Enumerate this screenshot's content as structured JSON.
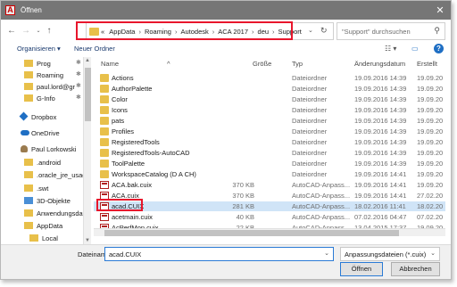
{
  "window": {
    "title": "Öffnen"
  },
  "address": {
    "prefix": "«",
    "crumbs": [
      "AppData",
      "Roaming",
      "Autodesk",
      "ACA 2017",
      "deu",
      "Support"
    ],
    "separator": "›"
  },
  "search": {
    "placeholder": "\"Support\" durchsuchen"
  },
  "toolbar": {
    "organize": "Organisieren ▾",
    "new_folder": "Neuer Ordner"
  },
  "sidebar": {
    "items": [
      {
        "label": "Prog",
        "icon": "folder-icon",
        "pinned": true
      },
      {
        "label": "Roaming",
        "icon": "folder-icon",
        "pinned": true
      },
      {
        "label": "paul.lord@gr",
        "icon": "folder-icon",
        "pinned": true
      },
      {
        "label": "G-Info",
        "icon": "folder-icon",
        "pinned": true
      },
      {
        "label": "Dropbox",
        "icon": "dropbox-icon",
        "pinned": false
      },
      {
        "label": "OneDrive",
        "icon": "onedrive-icon",
        "pinned": false
      },
      {
        "label": "Paul Lorkowski",
        "icon": "user-icon",
        "pinned": false
      },
      {
        "label": ".android",
        "icon": "folder-icon",
        "pinned": false
      },
      {
        "label": ".oracle_jre_usage",
        "icon": "folder-icon",
        "pinned": false
      },
      {
        "label": ".swt",
        "icon": "folder-icon",
        "pinned": false
      },
      {
        "label": "3D-Objekte",
        "icon": "3d-objects-icon",
        "pinned": false
      },
      {
        "label": "Anwendungsdat",
        "icon": "folder-icon",
        "pinned": false
      },
      {
        "label": "AppData",
        "icon": "folder-icon",
        "pinned": false
      },
      {
        "label": "Local",
        "icon": "folder-icon",
        "pinned": false
      }
    ]
  },
  "columns": {
    "name": "Name",
    "size": "Größe",
    "type": "Typ",
    "date": "Änderungsdatum",
    "created": "Erstellt"
  },
  "files": [
    {
      "name": "Actions",
      "size": "",
      "type": "Dateiordner",
      "date": "19.09.2016 14:39",
      "created": "19.09.20",
      "kind": "folder"
    },
    {
      "name": "AuthorPalette",
      "size": "",
      "type": "Dateiordner",
      "date": "19.09.2016 14:39",
      "created": "19.09.20",
      "kind": "folder"
    },
    {
      "name": "Color",
      "size": "",
      "type": "Dateiordner",
      "date": "19.09.2016 14:39",
      "created": "19.09.20",
      "kind": "folder"
    },
    {
      "name": "Icons",
      "size": "",
      "type": "Dateiordner",
      "date": "19.09.2016 14:39",
      "created": "19.09.20",
      "kind": "folder"
    },
    {
      "name": "pats",
      "size": "",
      "type": "Dateiordner",
      "date": "19.09.2016 14:39",
      "created": "19.09.20",
      "kind": "folder"
    },
    {
      "name": "Profiles",
      "size": "",
      "type": "Dateiordner",
      "date": "19.09.2016 14:39",
      "created": "19.09.20",
      "kind": "folder"
    },
    {
      "name": "RegisteredTools",
      "size": "",
      "type": "Dateiordner",
      "date": "19.09.2016 14:39",
      "created": "19.09.20",
      "kind": "folder"
    },
    {
      "name": "RegisteredTools-AutoCAD",
      "size": "",
      "type": "Dateiordner",
      "date": "19.09.2016 14:39",
      "created": "19.09.20",
      "kind": "folder"
    },
    {
      "name": "ToolPalette",
      "size": "",
      "type": "Dateiordner",
      "date": "19.09.2016 14:39",
      "created": "19.09.20",
      "kind": "folder"
    },
    {
      "name": "WorkspaceCatalog (D A CH)",
      "size": "",
      "type": "Dateiordner",
      "date": "19.09.2016 14:41",
      "created": "19.09.20",
      "kind": "folder"
    },
    {
      "name": "ACA.bak.cuix",
      "size": "370 KB",
      "type": "AutoCAD-Anpass...",
      "date": "19.09.2016 14:41",
      "created": "19.09.20",
      "kind": "cuix"
    },
    {
      "name": "ACA.cuix",
      "size": "370 KB",
      "type": "AutoCAD-Anpass...",
      "date": "19.09.2016 14:41",
      "created": "27.02.20",
      "kind": "cuix"
    },
    {
      "name": "acad.CUIX",
      "size": "281 KB",
      "type": "AutoCAD-Anpass...",
      "date": "18.02.2016 11:41",
      "created": "18.02.20",
      "kind": "cuix",
      "selected": true
    },
    {
      "name": "acetmain.cuix",
      "size": "40 KB",
      "type": "AutoCAD-Anpass...",
      "date": "07.02.2016 04:47",
      "created": "07.02.20",
      "kind": "cuix"
    },
    {
      "name": "AcPerfMon.cuix",
      "size": "22 KB",
      "type": "AutoCAD-Anpass...",
      "date": "13.04.2015 17:37",
      "created": "19.09.20",
      "kind": "cuix"
    }
  ],
  "bottom": {
    "filename_label": "Dateiname:",
    "filename_value": "acad.CUIX",
    "filter_value": "Anpassungsdateien (*.cuix)",
    "open_label": "Öffnen",
    "cancel_label": "Abbrechen"
  },
  "colors": {
    "highlight": "#e8162c",
    "selected_row": "#d0e4f7",
    "folder": "#e8c04a",
    "link": "#1a3a6e"
  }
}
